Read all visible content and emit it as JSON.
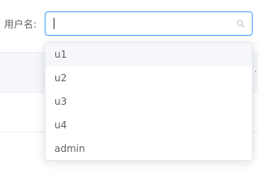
{
  "form": {
    "label": "用户名:",
    "input_value": "",
    "input_placeholder": ""
  },
  "icons": {
    "search": "search-icon"
  },
  "suggestions": [
    {
      "label": "u1",
      "highlighted": true
    },
    {
      "label": "u2",
      "highlighted": false
    },
    {
      "label": "u3",
      "highlighted": false
    },
    {
      "label": "u4",
      "highlighted": false
    },
    {
      "label": "admin",
      "highlighted": false
    }
  ],
  "colors": {
    "accent": "#409eff",
    "text": "#606266",
    "highlight_bg": "#f5f7fa"
  }
}
